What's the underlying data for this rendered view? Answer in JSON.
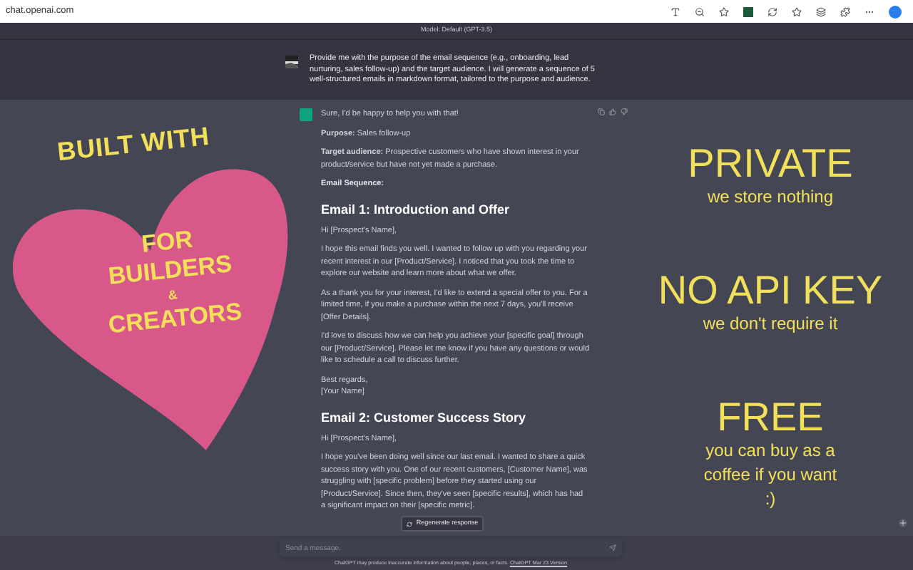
{
  "browser": {
    "url": "chat.openai.com"
  },
  "chat": {
    "model": "Model: Default (GPT-3.5)",
    "user_message": "Provide me with the purpose of the email sequence (e.g., onboarding, lead nurturing, sales follow-up) and the target audience. I will generate a sequence of 5 well-structured emails in markdown format, tailored to the purpose and audience.",
    "assistant_blocks": [
      {
        "kind": "p",
        "text": "Sure, I'd be happy to help you with that!"
      },
      {
        "kind": "p",
        "text": "**Purpose:** Sales follow-up"
      },
      {
        "kind": "p",
        "text": "**Target audience:** Prospective customers who have shown interest in your product/service but have not yet made a purchase."
      },
      {
        "kind": "label",
        "text": "Email Sequence:"
      },
      {
        "kind": "h",
        "text": "Email 1: Introduction and Offer"
      },
      {
        "kind": "p",
        "text": "Hi [Prospect's Name],"
      },
      {
        "kind": "p",
        "text": "I hope this email finds you well. I wanted to follow up with you regarding your recent interest in our [Product/Service]. I noticed that you took the time to explore our website and learn more about what we offer."
      },
      {
        "kind": "p",
        "text": "As a thank you for your interest, I'd like to extend a special offer to you. For a limited time, if you make a purchase within the next 7 days, you'll receive [Offer Details]."
      },
      {
        "kind": "p",
        "text": "I'd love to discuss how we can help you achieve your [specific goal] through our [Product/Service]. Please let me know if you have any questions or would like to schedule a call to discuss further."
      },
      {
        "kind": "lines",
        "lines": [
          "Best regards,",
          "[Your Name]"
        ]
      },
      {
        "kind": "h",
        "text": "Email 2: Customer Success Story"
      },
      {
        "kind": "p",
        "text": "Hi [Prospect's Name],"
      },
      {
        "kind": "p",
        "text": "I hope you've been doing well since our last email. I wanted to share a quick success story with you. One of our recent customers, [Customer Name], was struggling with [specific problem] before they started using our [Product/Service]. Since then, they've seen [specific results], which has had a significant impact on their [specific metric]."
      }
    ],
    "regenerate_button": "Regenerate response",
    "input": {
      "placeholder": "Send a message."
    },
    "footer": {
      "text": "ChatGPT may produce inaccurate information about people, places, or facts.",
      "link": "ChatGPT Mar 23 Version"
    }
  },
  "overlay": {
    "title": "BUILT WITH",
    "heart_lines": [
      "FOR",
      "BUILDERS",
      "&",
      "CREATORS"
    ],
    "features": [
      {
        "heading": "PRIVATE",
        "sub_lines": [
          "we store nothing"
        ]
      },
      {
        "heading": "NO API KEY",
        "sub_lines": [
          "we don't require it"
        ]
      },
      {
        "heading": "FREE",
        "sub_lines": [
          "you can buy as a",
          "coffee if you want",
          ":)"
        ]
      }
    ]
  }
}
